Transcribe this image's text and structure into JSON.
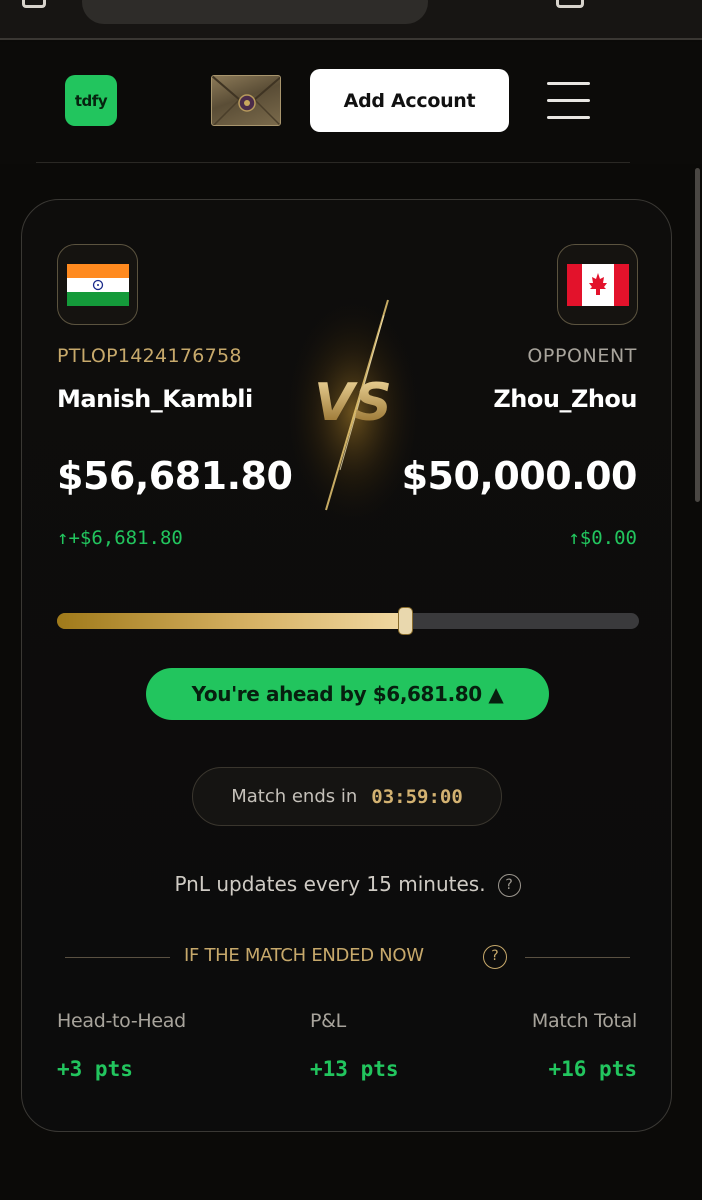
{
  "header": {
    "logo_text": "tdfy",
    "add_account_label": "Add Account"
  },
  "match": {
    "player": {
      "id": "PTLOP1424176758",
      "name": "Manish_Kambli",
      "balance": "$56,681.80",
      "change": "↑+$6,681.80",
      "flag": "india-flag"
    },
    "opponent": {
      "label": "OPPONENT",
      "name": "Zhou_Zhou",
      "balance": "$50,000.00",
      "change": "↑$0.00",
      "flag": "canada-flag"
    },
    "vs_text": "VS",
    "progress": {
      "player_share": 0.6
    },
    "ahead_text": "You're ahead by $6,681.80 ▲",
    "ends_label": "Match ends in",
    "ends_time": "03:59:00",
    "pnl_note": "PnL updates every 15 minutes.",
    "section_title": "IF THE MATCH ENDED NOW",
    "stats": [
      {
        "label": "Head-to-Head",
        "value": "+3 pts"
      },
      {
        "label": "P&L",
        "value": "+13 pts"
      },
      {
        "label": "Match Total",
        "value": "+16 pts"
      }
    ]
  },
  "colors": {
    "accent_green": "#22c55e",
    "gold": "#c7a96b",
    "background": "#0b0a08"
  }
}
